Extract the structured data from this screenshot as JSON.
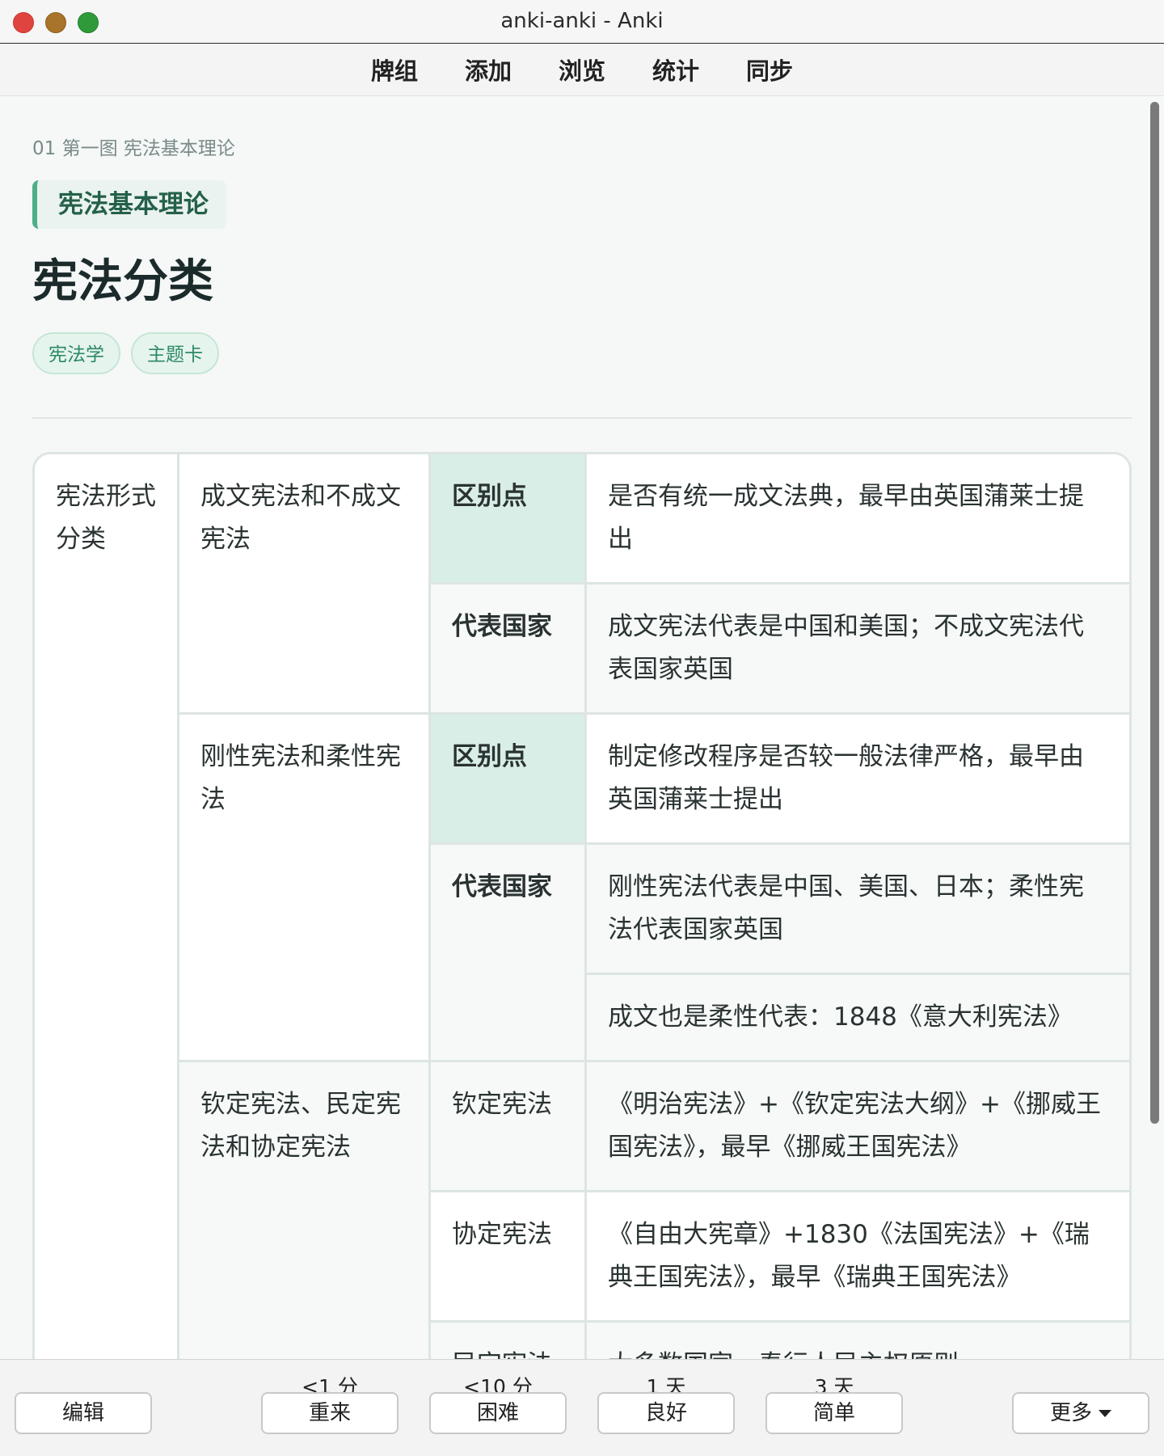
{
  "window": {
    "title": "anki-anki - Anki"
  },
  "nav": {
    "items": [
      "牌组",
      "添加",
      "浏览",
      "统计",
      "同步"
    ]
  },
  "card": {
    "breadcrumb": "01 第一图 宪法基本理论",
    "section": "宪法基本理论",
    "title": "宪法分类",
    "tags": [
      "宪法学",
      "主题卡"
    ],
    "table": {
      "category": "宪法形式分类",
      "groups": [
        {
          "name": "成文宪法和不成文宪法",
          "rows": [
            {
              "key": "区别点",
              "value": "是否有统一成文法典，最早由英国蒲莱士提出"
            },
            {
              "key": "代表国家",
              "value": "成文宪法代表是中国和美国；不成文宪法代表国家英国"
            }
          ]
        },
        {
          "name": "刚性宪法和柔性宪法",
          "rows": [
            {
              "key": "区别点",
              "value": "制定修改程序是否较一般法律严格，最早由英国蒲莱士提出"
            },
            {
              "key": "代表国家",
              "value": "刚性宪法代表是中国、美国、日本；柔性宪法代表国家英国",
              "extra": "成文也是柔性代表：1848《意大利宪法》"
            }
          ]
        },
        {
          "name": "钦定宪法、民定宪法和协定宪法",
          "rows": [
            {
              "key": "钦定宪法",
              "value": "《明治宪法》+《钦定宪法大纲》+《挪威王国宪法》，最早《挪威王国宪法》"
            },
            {
              "key": "协定宪法",
              "value": "《自由大宪章》+1830《法国宪法》+《瑞典王国宪法》，最早《瑞典王国宪法》"
            },
            {
              "key": "民定宪法",
              "value": "大多数国家，奉行人民主权原则"
            }
          ]
        }
      ]
    }
  },
  "bottom": {
    "edit": "编辑",
    "more": "更多",
    "answers": [
      {
        "due": "<1 分",
        "label": "重来"
      },
      {
        "due": "<10 分",
        "label": "困难"
      },
      {
        "due": "1 天",
        "label": "良好"
      },
      {
        "due": "3 天",
        "label": "简单"
      }
    ]
  }
}
